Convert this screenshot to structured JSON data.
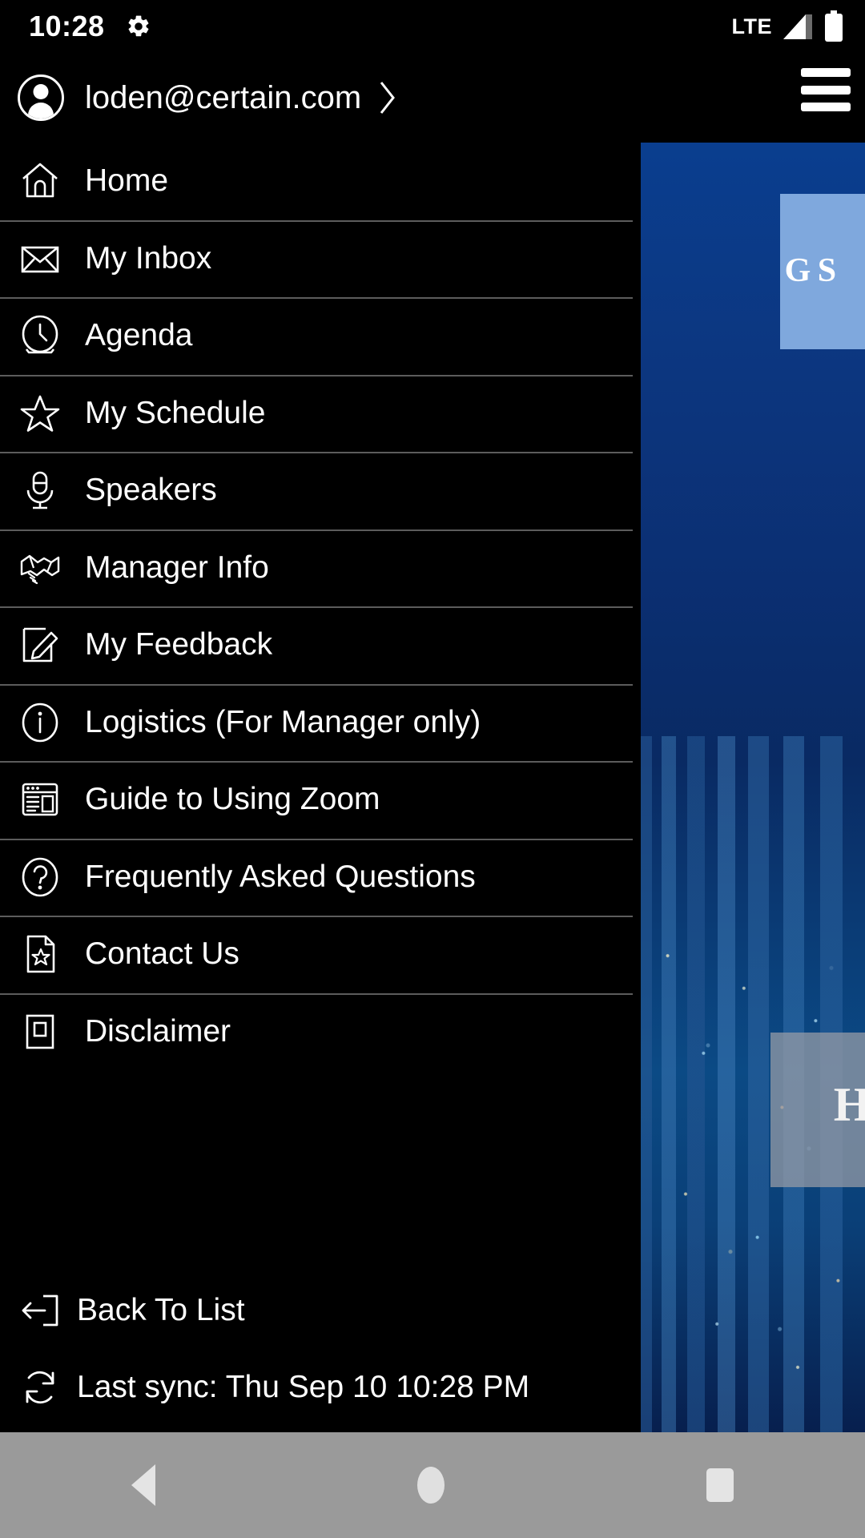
{
  "status_bar": {
    "time": "10:28",
    "gear_icon": "gear-icon",
    "network_label": "LTE",
    "signal_icon": "signal-bars-icon",
    "battery_icon": "battery-icon"
  },
  "drawer": {
    "account": {
      "email": "loden@certain.com",
      "avatar_icon": "user-avatar-icon",
      "chevron_icon": "chevron-right-icon"
    },
    "hamburger_icon": "hamburger-menu-icon",
    "items": [
      {
        "label": "Home",
        "icon": "home-icon"
      },
      {
        "label": "My Inbox",
        "icon": "envelope-icon"
      },
      {
        "label": "Agenda",
        "icon": "clock-icon"
      },
      {
        "label": "My Schedule",
        "icon": "star-icon"
      },
      {
        "label": "Speakers",
        "icon": "microphone-icon"
      },
      {
        "label": "Manager Info",
        "icon": "handshake-icon"
      },
      {
        "label": "My Feedback",
        "icon": "edit-note-icon"
      },
      {
        "label": "Logistics (For Manager only)",
        "icon": "info-circle-icon"
      },
      {
        "label": "Guide to Using Zoom",
        "icon": "browser-layout-icon"
      },
      {
        "label": "Frequently Asked Questions",
        "icon": "question-circle-icon"
      },
      {
        "label": "Contact Us",
        "icon": "document-star-icon"
      },
      {
        "label": "Disclaimer",
        "icon": "document-box-icon"
      }
    ],
    "footer": {
      "back_to_list": {
        "label": "Back To List",
        "icon": "exit-arrow-icon"
      },
      "last_sync": {
        "label": "Last sync: Thu Sep 10 10:28 PM",
        "icon": "sync-refresh-icon"
      }
    }
  },
  "background": {
    "banner_text": "G\nS",
    "card_letter": "H"
  },
  "nav_bar": {
    "back_icon": "triangle-back-icon",
    "home_icon": "circle-home-icon",
    "recent_icon": "square-recents-icon"
  },
  "colors": {
    "drawer_bg": "#000000",
    "divider": "#5c5c5c",
    "text": "#ffffff",
    "navbar_bg": "#9a9a9a",
    "photo_blue": "#0a3070"
  }
}
